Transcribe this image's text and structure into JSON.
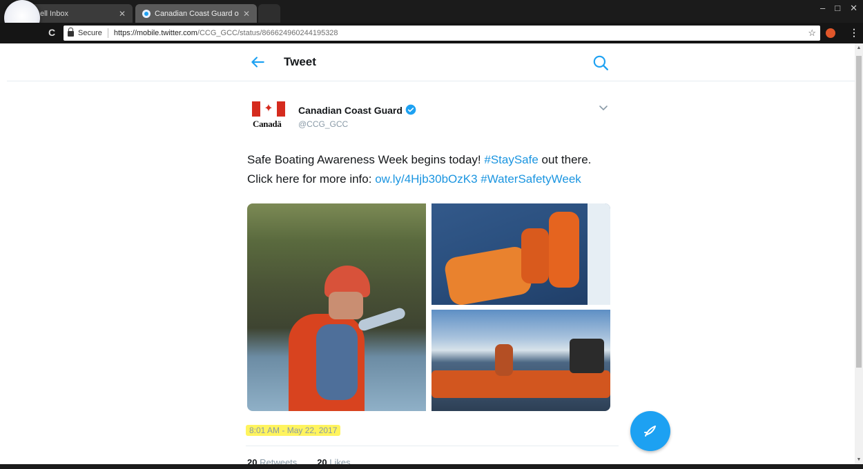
{
  "browser": {
    "tabs": [
      {
        "label": "ell Inbox"
      },
      {
        "label": "Canadian Coast Guard o"
      }
    ],
    "address": {
      "secure_label": "Secure",
      "url_host": "https://mobile.twitter.com",
      "url_path": "/CCG_GCC/status/866624960244195328"
    },
    "window_controls": [
      "–",
      "□",
      "✕"
    ]
  },
  "header": {
    "title": "Tweet"
  },
  "tweet": {
    "avatar_wordmark": "Canadä",
    "display_name": "Canadian Coast Guard",
    "handle": "@CCG_GCC",
    "text_line1_a": "Safe Boating Awareness Week begins today! ",
    "text_line1_hashtag": "#StaySafe",
    "text_line1_b": " out there.",
    "text_line2_a": "Click here for more info: ",
    "text_line2_link": "ow.ly/4Hjb30bOzK3",
    "text_line2_hashtag": "#WaterSafetyWeek",
    "timestamp": "8:01 AM - May 22, 2017",
    "stats": {
      "retweets_count": "20",
      "retweets_label": "Retweets",
      "likes_count": "20",
      "likes_label": "Likes"
    }
  },
  "colors": {
    "accent": "#1da1f2",
    "link": "#1b95e0",
    "highlight": "#fff45e",
    "canada_red": "#d52b1e"
  },
  "icons": {
    "back": "arrow-left-icon",
    "search": "search-icon",
    "verified": "verified-badge-icon",
    "more": "chevron-down-icon",
    "compose": "feather-compose-icon"
  }
}
